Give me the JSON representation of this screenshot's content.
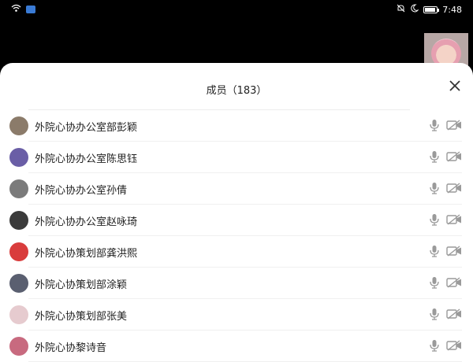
{
  "status_bar": {
    "time": "7:48",
    "left_icons": [
      "wifi-icon",
      "app-badge-icon"
    ],
    "right_icons": [
      "bell-off-icon",
      "moon-icon",
      "battery-icon"
    ],
    "battery_level": 0.95
  },
  "sheet": {
    "title": "成员（183）",
    "close_icon": "close-icon"
  },
  "members": [
    {
      "name": "外院心协办公室部彭颖",
      "avatar_color": "#8b7b6a"
    },
    {
      "name": "外院心协办公室陈思钰",
      "avatar_color": "#6a5ea6"
    },
    {
      "name": "外院心协办公室孙倩",
      "avatar_color": "#7b7b7b"
    },
    {
      "name": "外院心协办公室赵咏琦",
      "avatar_color": "#3b3b3b"
    },
    {
      "name": "外院心协策划部龚洪熙",
      "avatar_color": "#d93c3c"
    },
    {
      "name": "外院心协策划部涂颖",
      "avatar_color": "#5a5f70"
    },
    {
      "name": "外院心协策划部张美",
      "avatar_color": "#e6cbcf"
    },
    {
      "name": "外院心协黎诗音",
      "avatar_color": "#c86a7f"
    }
  ],
  "member_icons": [
    "microphone-icon",
    "camera-off-icon"
  ]
}
